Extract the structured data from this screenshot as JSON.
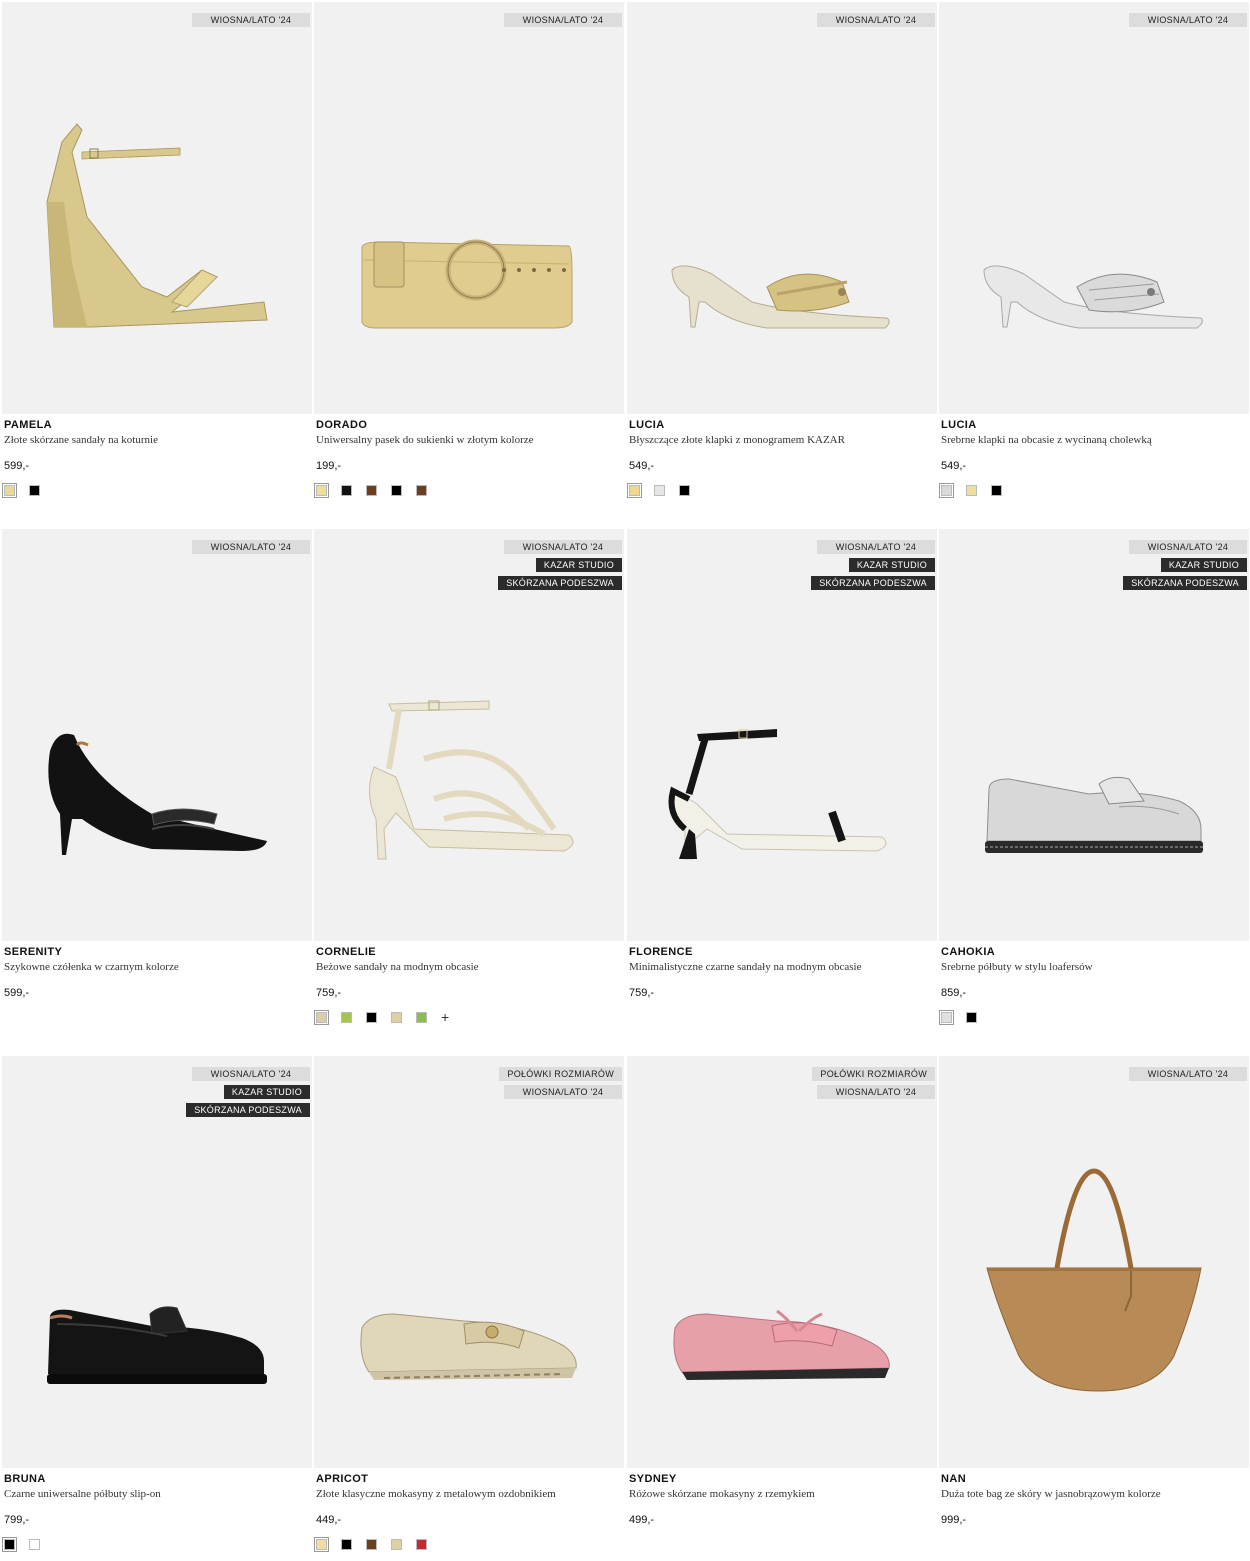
{
  "products": [
    {
      "name": "PAMELA",
      "desc": "Złote skórzane sandały na koturnie",
      "price": "599,-",
      "tags": [
        {
          "text": "WIOSNA/LATO '24",
          "style": "light"
        }
      ],
      "swatches": [
        "#e9d89c",
        "#000000"
      ],
      "icon": "wedge-sandal-image"
    },
    {
      "name": "DORADO",
      "desc": "Uniwersalny pasek do sukienki w złotym kolorze",
      "price": "199,-",
      "tags": [
        {
          "text": "WIOSNA/LATO '24",
          "style": "light"
        }
      ],
      "swatches": [
        "#efdd9c",
        "#111111",
        "#6b3f1f",
        "#000000",
        "#6b3f1f"
      ],
      "icon": "belt-image"
    },
    {
      "name": "LUCIA",
      "desc": "Błyszczące złote klapki z monogramem KAZAR",
      "price": "549,-",
      "tags": [
        {
          "text": "WIOSNA/LATO '24",
          "style": "light"
        }
      ],
      "swatches": [
        "#f0d98e",
        "#e6e6e6",
        "#000000"
      ],
      "icon": "mule-image"
    },
    {
      "name": "LUCIA",
      "desc": "Srebrne klapki na obcasie z wycinaną cholewką",
      "price": "549,-",
      "tags": [
        {
          "text": "WIOSNA/LATO '24",
          "style": "light"
        }
      ],
      "swatches": [
        "#d9d9d9",
        "#f0dea0",
        "#000000"
      ],
      "icon": "silver-mule-image"
    },
    {
      "name": "SERENITY",
      "desc": "Szykowne czółenka w czarnym kolorze",
      "price": "599,-",
      "tags": [
        {
          "text": "WIOSNA/LATO '24",
          "style": "light"
        }
      ],
      "swatches": [],
      "icon": "pump-image"
    },
    {
      "name": "CORNELIE",
      "desc": "Beżowe sandały na modnym obcasie",
      "price": "759,-",
      "tags": [
        {
          "text": "WIOSNA/LATO '24",
          "style": "light"
        },
        {
          "text": "KAZAR STUDIO",
          "style": "dark"
        },
        {
          "text": "SKÓRZANA PODESZWA",
          "style": "dark"
        }
      ],
      "swatches": [
        "#d8cfa8",
        "#a6c34e",
        "#000000",
        "#e0cfa0",
        "#8bbd52"
      ],
      "more": "+",
      "icon": "strappy-sandal-image"
    },
    {
      "name": "FLORENCE",
      "desc": "Minimalistyczne czarne sandały na modnym obcasie",
      "price": "759,-",
      "tags": [
        {
          "text": "WIOSNA/LATO '24",
          "style": "light"
        },
        {
          "text": "KAZAR STUDIO",
          "style": "dark"
        },
        {
          "text": "SKÓRZANA PODESZWA",
          "style": "dark"
        }
      ],
      "swatches": [],
      "icon": "black-sandal-image"
    },
    {
      "name": "CAHOKIA",
      "desc": "Srebrne półbuty w stylu loafersów",
      "price": "859,-",
      "tags": [
        {
          "text": "WIOSNA/LATO '24",
          "style": "light"
        },
        {
          "text": "KAZAR STUDIO",
          "style": "dark"
        },
        {
          "text": "SKÓRZANA PODESZWA",
          "style": "dark"
        }
      ],
      "swatches": [
        "#e0e0e0",
        "#000000"
      ],
      "icon": "silver-loafer-image"
    },
    {
      "name": "BRUNA",
      "desc": "Czarne uniwersalne półbuty slip-on",
      "price": "799,-",
      "tags": [
        {
          "text": "WIOSNA/LATO '24",
          "style": "light"
        },
        {
          "text": "KAZAR STUDIO",
          "style": "dark"
        },
        {
          "text": "SKÓRZANA PODESZWA",
          "style": "dark"
        }
      ],
      "swatches": [
        "#000000",
        "#ffffff"
      ],
      "icon": "black-loafer-image"
    },
    {
      "name": "APRICOT",
      "desc": "Złote klasyczne mokasyny z metalowym ozdobnikiem",
      "price": "449,-",
      "tags": [
        {
          "text": "POŁÓWKI ROZMIARÓW",
          "style": "light"
        },
        {
          "text": "WIOSNA/LATO '24",
          "style": "light"
        }
      ],
      "swatches": [
        "#f0dea0",
        "#000000",
        "#6b3f1f",
        "#e0cfa0",
        "#c8282f"
      ],
      "icon": "gold-moccasin-image"
    },
    {
      "name": "SYDNEY",
      "desc": "Różowe skórzane mokasyny z rzemykiem",
      "price": "499,-",
      "tags": [
        {
          "text": "POŁÓWKI ROZMIARÓW",
          "style": "light"
        },
        {
          "text": "WIOSNA/LATO '24",
          "style": "light"
        }
      ],
      "swatches": [],
      "icon": "pink-moccasin-image"
    },
    {
      "name": "NAN",
      "desc": "Duża tote bag ze skóry w jasnobrązowym kolorze",
      "price": "999,-",
      "tags": [
        {
          "text": "WIOSNA/LATO '24",
          "style": "light"
        }
      ],
      "swatches": [],
      "icon": "tote-bag-image"
    }
  ]
}
